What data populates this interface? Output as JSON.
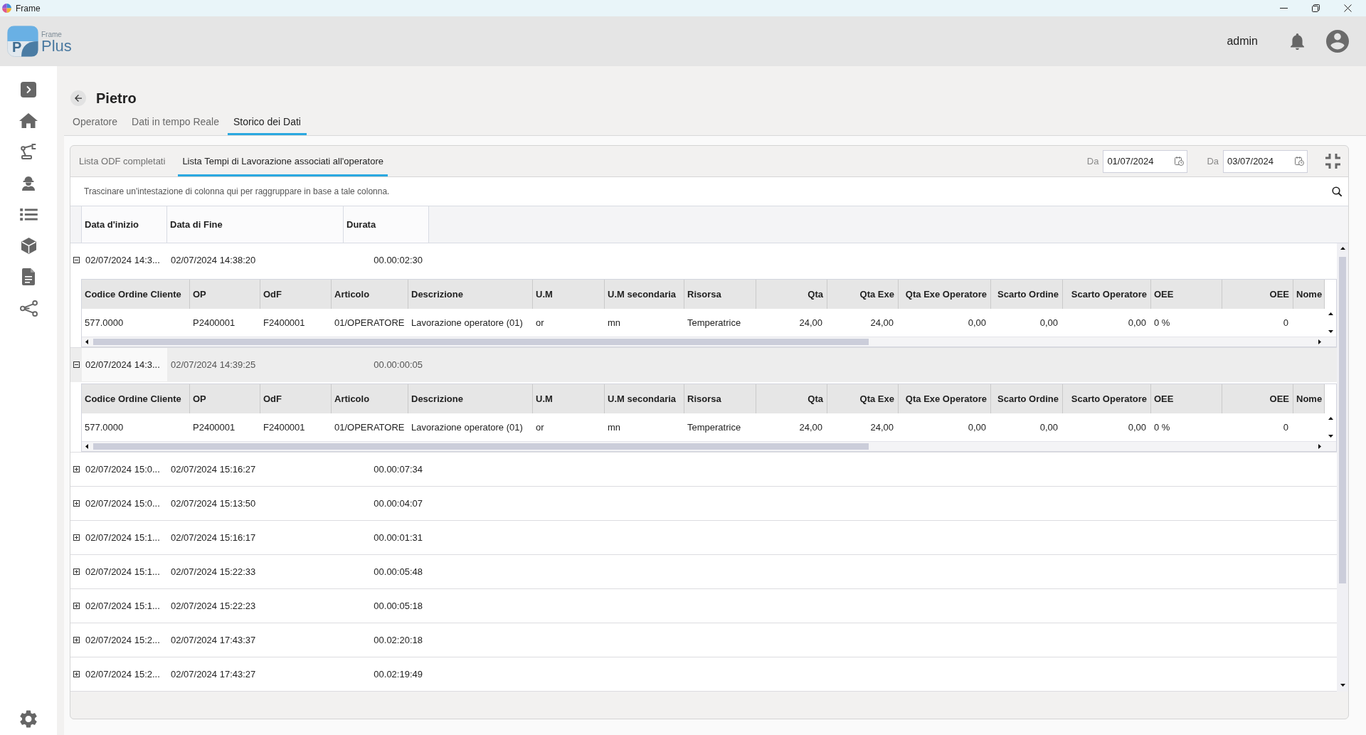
{
  "titlebar": {
    "title": "Frame"
  },
  "header": {
    "logo": {
      "mark": "P",
      "caption": "Frame",
      "name": "Plus"
    },
    "user": "admin"
  },
  "page": {
    "title": "Pietro",
    "tabs": [
      {
        "label": "Operatore",
        "selected": false
      },
      {
        "label": "Dati in tempo Reale",
        "selected": false
      },
      {
        "label": "Storico dei Dati",
        "selected": true
      }
    ]
  },
  "panel": {
    "tabs": [
      {
        "label": "Lista ODF completati",
        "selected": false
      },
      {
        "label": "Lista Tempi di Lavorazione associati all'operatore",
        "selected": true
      }
    ],
    "date_filters": [
      {
        "label": "Da",
        "value": "01/07/2024"
      },
      {
        "label": "Da",
        "value": "03/07/2024"
      }
    ]
  },
  "grid": {
    "group_panel": "Trascinare un'intestazione di colonna qui per raggruppare in base a tale colonna.",
    "columns": [
      "Data d'inizio",
      "Data di Fine",
      "Durata"
    ],
    "rows": [
      {
        "start": "02/07/2024 14:3...",
        "end": "02/07/2024 14:38:20",
        "duration": "00.00:02:30",
        "expanded": true,
        "selected": false,
        "detail": {
          "columns": [
            {
              "label": "Codice Ordine Cliente",
              "kind": "text"
            },
            {
              "label": "OP",
              "kind": "text"
            },
            {
              "label": "OdF",
              "kind": "text"
            },
            {
              "label": "Articolo",
              "kind": "text"
            },
            {
              "label": "Descrizione",
              "kind": "text"
            },
            {
              "label": "U.M",
              "kind": "text"
            },
            {
              "label": "U.M secondaria",
              "kind": "text"
            },
            {
              "label": "Risorsa",
              "kind": "text"
            },
            {
              "label": "Qta",
              "kind": "number"
            },
            {
              "label": "Qta Exe",
              "kind": "number"
            },
            {
              "label": "Qta Exe Operatore",
              "kind": "number"
            },
            {
              "label": "Scarto Ordine",
              "kind": "number"
            },
            {
              "label": "Scarto Operatore",
              "kind": "number"
            },
            {
              "label": "OEE",
              "kind": "text"
            },
            {
              "label": "OEE",
              "kind": "number"
            },
            {
              "label": "Nome",
              "kind": "text"
            }
          ],
          "rows": [
            [
              "577.0000",
              "P2400001",
              "F2400001",
              "01/OPERATORE",
              "Lavorazione operatore (01)",
              "or",
              "mn",
              "Temperatrice",
              "24,00",
              "24,00",
              "0,00",
              "0,00",
              "0,00",
              "0 %",
              "0"
            ]
          ]
        }
      },
      {
        "start": "02/07/2024 14:3...",
        "end": "02/07/2024 14:39:25",
        "duration": "00.00:00:05",
        "expanded": true,
        "selected": true,
        "detail": {
          "columns": [
            {
              "label": "Codice Ordine Cliente",
              "kind": "text"
            },
            {
              "label": "OP",
              "kind": "text"
            },
            {
              "label": "OdF",
              "kind": "text"
            },
            {
              "label": "Articolo",
              "kind": "text"
            },
            {
              "label": "Descrizione",
              "kind": "text"
            },
            {
              "label": "U.M",
              "kind": "text"
            },
            {
              "label": "U.M secondaria",
              "kind": "text"
            },
            {
              "label": "Risorsa",
              "kind": "text"
            },
            {
              "label": "Qta",
              "kind": "number"
            },
            {
              "label": "Qta Exe",
              "kind": "number"
            },
            {
              "label": "Qta Exe Operatore",
              "kind": "number"
            },
            {
              "label": "Scarto Ordine",
              "kind": "number"
            },
            {
              "label": "Scarto Operatore",
              "kind": "number"
            },
            {
              "label": "OEE",
              "kind": "text"
            },
            {
              "label": "OEE",
              "kind": "number"
            },
            {
              "label": "Nome",
              "kind": "text"
            }
          ],
          "rows": [
            [
              "577.0000",
              "P2400001",
              "F2400001",
              "01/OPERATORE",
              "Lavorazione operatore (01)",
              "or",
              "mn",
              "Temperatrice",
              "24,00",
              "24,00",
              "0,00",
              "0,00",
              "0,00",
              "0 %",
              "0"
            ]
          ]
        }
      },
      {
        "start": "02/07/2024 15:0...",
        "end": "02/07/2024 15:16:27",
        "duration": "00.00:07:34",
        "expanded": false,
        "selected": false
      },
      {
        "start": "02/07/2024 15:0...",
        "end": "02/07/2024 15:13:50",
        "duration": "00.00:04:07",
        "expanded": false,
        "selected": false
      },
      {
        "start": "02/07/2024 15:1...",
        "end": "02/07/2024 15:16:17",
        "duration": "00.00:01:31",
        "expanded": false,
        "selected": false
      },
      {
        "start": "02/07/2024 15:1...",
        "end": "02/07/2024 15:22:33",
        "duration": "00.00:05:48",
        "expanded": false,
        "selected": false
      },
      {
        "start": "02/07/2024 15:1...",
        "end": "02/07/2024 15:22:23",
        "duration": "00.00:05:18",
        "expanded": false,
        "selected": false
      },
      {
        "start": "02/07/2024 15:2...",
        "end": "02/07/2024 17:43:37",
        "duration": "00.02:20:18",
        "expanded": false,
        "selected": false
      },
      {
        "start": "02/07/2024 15:2...",
        "end": "02/07/2024 17:43:27",
        "duration": "00.02:19:49",
        "expanded": false,
        "selected": false
      }
    ]
  }
}
